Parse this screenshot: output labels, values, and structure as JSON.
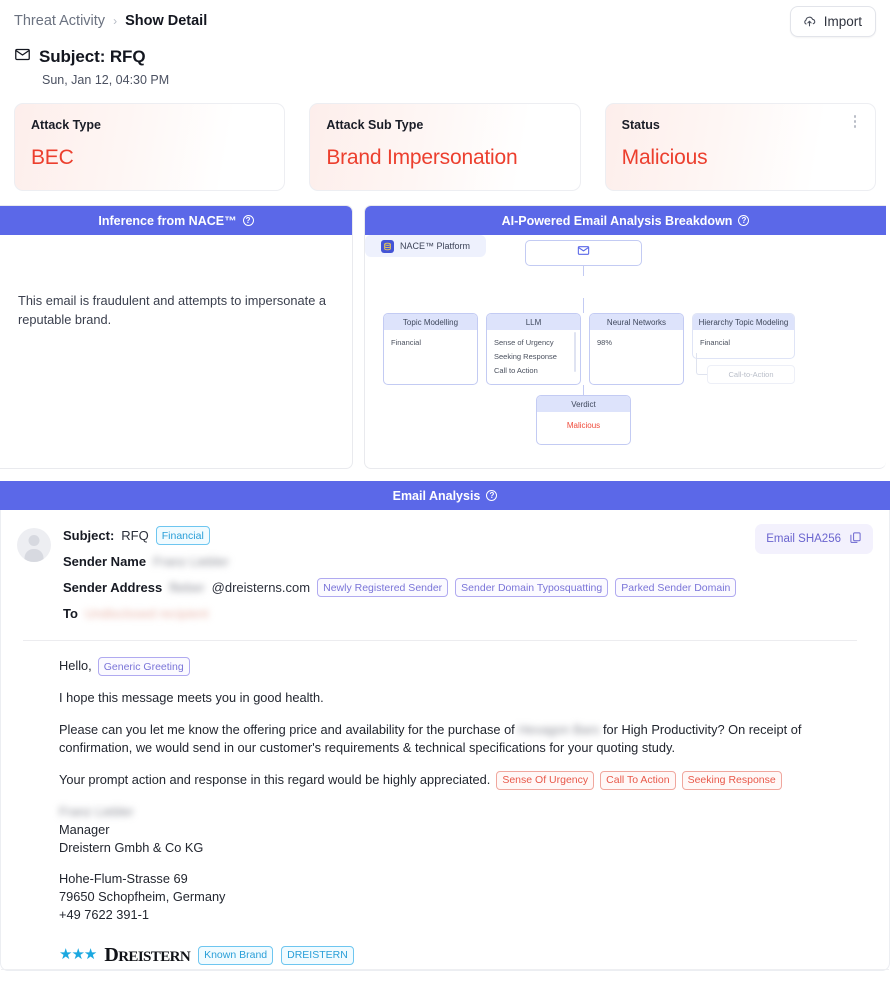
{
  "breadcrumb": {
    "root": "Threat Activity",
    "separator": "›",
    "current": "Show Detail"
  },
  "toolbar": {
    "import_label": "Import",
    "import_icon": "cloud-upload-icon"
  },
  "header": {
    "mail_icon": "envelope-icon",
    "subject": "Subject: RFQ",
    "date": "Sun, Jan 12, 04:30 PM"
  },
  "cards": [
    {
      "label": "Attack Type",
      "value": "BEC"
    },
    {
      "label": "Attack Sub Type",
      "value": "Brand Impersonation"
    },
    {
      "label": "Status",
      "value": "Malicious",
      "menu_icon": "kebab-menu-icon"
    }
  ],
  "nace_panel": {
    "title": "Inference from NACE™",
    "info_icon": "info-icon",
    "text": "This email is fraudulent and attempts to impersonate a reputable brand."
  },
  "ai_panel": {
    "title": "AI-Powered Email Analysis Breakdown",
    "info_icon": "info-icon",
    "email_node_icon": "envelope-icon",
    "platform_node": {
      "label": "NACE™ Platform",
      "icon": "database-icon"
    },
    "nodes": [
      {
        "title": "Topic Modelling",
        "items": [
          "Financial"
        ]
      },
      {
        "title": "LLM",
        "items": [
          "Sense of Urgency",
          "Seeking Response",
          "Call to Action"
        ]
      },
      {
        "title": "Neural Networks",
        "items": [
          "98%"
        ]
      },
      {
        "title": "Hierarchy Topic Modeling",
        "items": [
          "Financial"
        ],
        "child": "Call-to-Action"
      }
    ],
    "verdict": {
      "title": "Verdict",
      "value": "Malicious"
    }
  },
  "email_analysis": {
    "title": "Email Analysis",
    "info_icon": "info-icon",
    "sha_button": {
      "label": "Email SHA256",
      "icon": "copy-icon"
    },
    "avatar_icon": "user-avatar-icon",
    "subject_key": "Subject:",
    "subject_value": "RFQ",
    "subject_tag": "Financial",
    "sender_name_key": "Sender Name",
    "sender_name_value": "Franz Liebler",
    "sender_address_key": "Sender Address",
    "sender_address_user": "flieber",
    "sender_address_domain": "@dreisterns.com",
    "sender_tags": [
      "Newly Registered Sender",
      "Sender Domain Typosquatting",
      "Parked Sender Domain"
    ],
    "to_key": "To",
    "to_value": "Undisclosed recipient",
    "body": {
      "greeting": "Hello,",
      "greeting_tag": "Generic Greeting",
      "line1": "I hope this message meets you in good health.",
      "line2_a": "Please can you let me know the offering price and availability for the purchase of",
      "line2_redacted": "Hexagon Bars",
      "line2_b": "for High Productivity? On receipt of confirmation, we would send in our customer's requirements & technical specifications for your quoting study.",
      "line3": "Your prompt action and response in this regard would be highly appreciated.",
      "line3_tags": [
        "Sense Of Urgency",
        "Call To Action",
        "Seeking Response"
      ],
      "sig_name": "Franz Liebler",
      "sig_title": "Manager",
      "sig_company": "Dreistern Gmbh & Co KG",
      "sig_street": "Hohe-Flum-Strasse 69",
      "sig_city": "79650 Schopfheim, Germany",
      "sig_phone": "+49 7622 391-1",
      "brand_stars": "★★★",
      "brand_name_a": "D",
      "brand_name_b": "REISTERN",
      "brand_tags": [
        "Known Brand",
        "DREISTERN"
      ]
    }
  },
  "colors": {
    "accent": "#5b68e8",
    "danger": "#ec3f2e",
    "brand_blue": "#1ba8e0"
  }
}
